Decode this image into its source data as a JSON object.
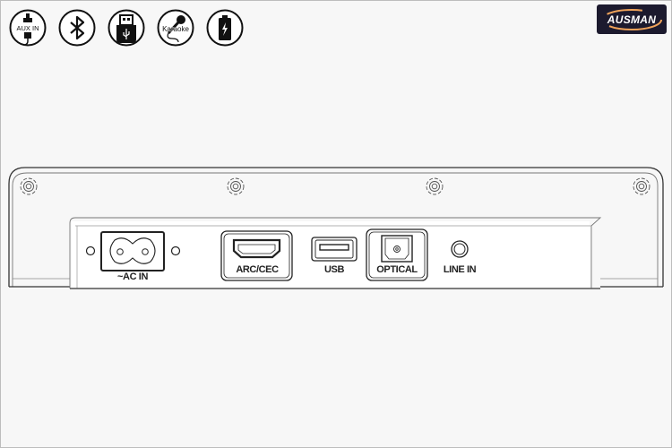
{
  "brand": {
    "logo_text": "AUSMAN",
    "colors": {
      "logo_bg": "#1c1a2e",
      "logo_swoosh": "#f0a35a"
    }
  },
  "feature_icons": [
    {
      "name": "aux-in-icon",
      "label": "AUX IN"
    },
    {
      "name": "bluetooth-icon",
      "label": ""
    },
    {
      "name": "usb-icon",
      "label": ""
    },
    {
      "name": "karaoke-icon",
      "label": "Karaoke"
    },
    {
      "name": "battery-icon",
      "label": ""
    }
  ],
  "ports": [
    {
      "name": "ac-in-port",
      "label": "~AC IN"
    },
    {
      "name": "hdmi-arc-port",
      "label": "ARC/CEC"
    },
    {
      "name": "usb-port",
      "label": "USB"
    },
    {
      "name": "optical-port",
      "label": "OPTICAL"
    },
    {
      "name": "line-in-port",
      "label": "LINE IN"
    }
  ]
}
